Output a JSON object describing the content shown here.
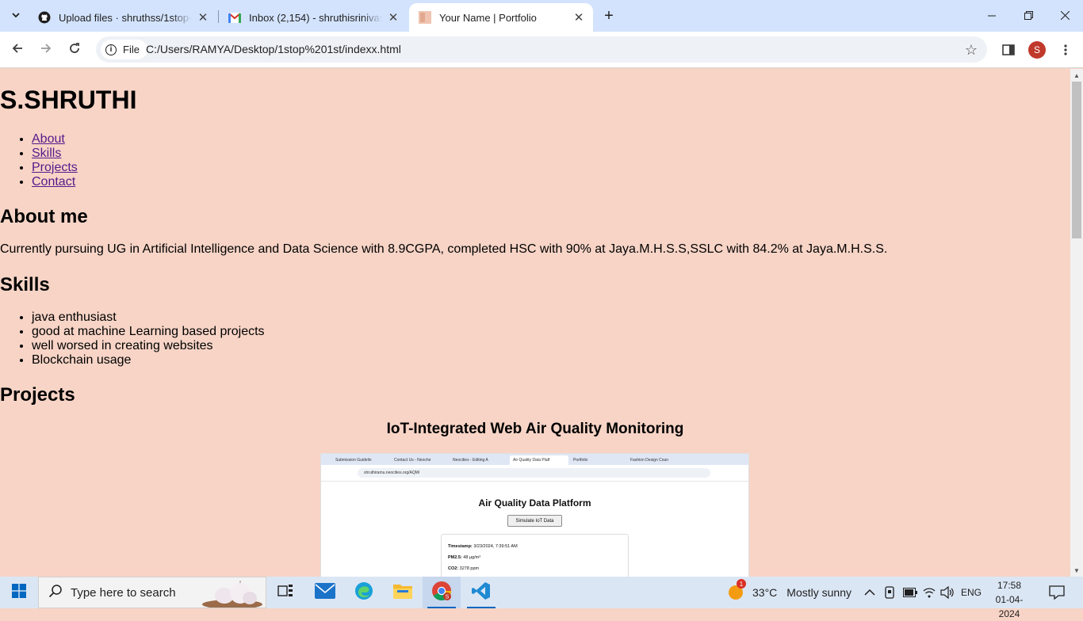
{
  "browser": {
    "tabs": [
      {
        "title": "Upload files · shruthss/1stop-interns",
        "favicon": "github-icon",
        "active": false
      },
      {
        "title": "Inbox (2,154) - shruthisrinivasan",
        "favicon": "gmail-icon",
        "active": false
      },
      {
        "title": "Your Name | Portfolio",
        "favicon": "page-thumbnail-icon",
        "active": true
      }
    ],
    "site_chip": "File",
    "url": "C:/Users/RAMYA/Desktop/1stop%201st/indexx.html",
    "profile_initial": "S"
  },
  "page": {
    "name": "S.SHRUTHI",
    "nav": [
      "About",
      "Skills",
      "Projects",
      "Contact"
    ],
    "about_heading": "About me",
    "about_text": "Currently pursuing UG in Artificial Intelligence and Data Science with 8.9CGPA, completed HSC with 90% at Jaya.M.H.S.S,SSLC with 84.2% at Jaya.M.H.S.S.",
    "skills_heading": "Skills",
    "skills": [
      "java enthusiast",
      "good at machine Learning based projects",
      "well worsed in creating websites",
      "Blockchain usage"
    ],
    "projects_heading": "Projects",
    "project_title": "IoT-Integrated Web Air Quality Monitoring",
    "project_screenshot": {
      "tabs": [
        "Submission Guidelin",
        "Contact Us - Neoche",
        "Neocities - Editing A",
        "Air Quality Data Platf",
        "Portfolio",
        "Fashion Design Coun"
      ],
      "url": "shruthiramu.neocities.org/AQM/",
      "title": "Air Quality Data Platform",
      "button": "Simulate IoT Data",
      "rows": [
        {
          "label": "Timestamp:",
          "value": "3/23/2024, 7:39:51 AM"
        },
        {
          "label": "PM2.5:",
          "value": "48 µg/m³"
        },
        {
          "label": "CO2:",
          "value": "3278 ppm"
        }
      ]
    }
  },
  "taskbar": {
    "search_placeholder": "Type here to search",
    "weather_temp": "33°C",
    "weather_desc": "Mostly sunny",
    "weather_badge": "1",
    "language": "ENG",
    "time": "17:58",
    "date": "01-04-2024"
  }
}
